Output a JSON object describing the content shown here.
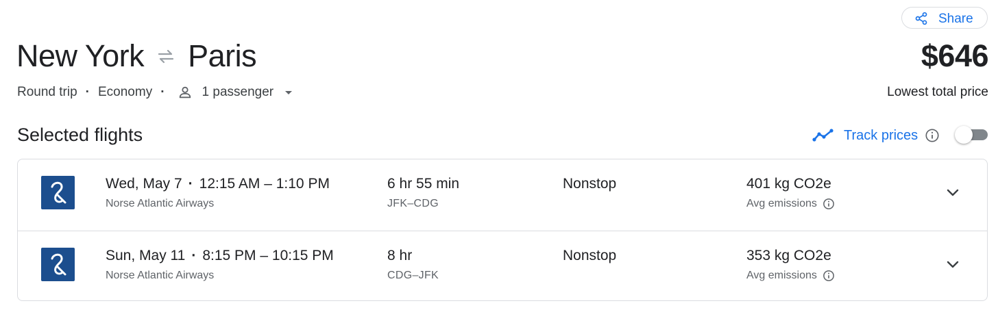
{
  "header": {
    "share_label": "Share",
    "origin": "New York",
    "destination": "Paris",
    "price": "$646",
    "price_caption": "Lowest total price"
  },
  "trip": {
    "type": "Round trip",
    "cabin": "Economy",
    "passengers": "1 passenger"
  },
  "section": {
    "title": "Selected flights",
    "track_prices_label": "Track prices",
    "track_prices_enabled": false
  },
  "flights": [
    {
      "date": "Wed, May 7",
      "times": "12:15 AM – 1:10 PM",
      "airline": "Norse Atlantic Airways",
      "duration": "6 hr 55 min",
      "route": "JFK–CDG",
      "stops": "Nonstop",
      "emissions": "401 kg CO2e",
      "emissions_label": "Avg emissions"
    },
    {
      "date": "Sun, May 11",
      "times": "8:15 PM – 10:15 PM",
      "airline": "Norse Atlantic Airways",
      "duration": "8 hr",
      "route": "CDG–JFK",
      "stops": "Nonstop",
      "emissions": "353 kg CO2e",
      "emissions_label": "Avg emissions"
    }
  ],
  "icons": {
    "share": "share-icon",
    "swap": "swap-arrows-icon",
    "person": "person-icon",
    "dropdown": "caret-down-icon",
    "trend": "trend-line-icon",
    "info": "info-icon",
    "expand": "chevron-down-icon",
    "airline_logo": "norse-logo"
  },
  "colors": {
    "accent": "#1a73e8",
    "airline_logo_bg": "#1c4e8e",
    "border": "#dadce0"
  }
}
